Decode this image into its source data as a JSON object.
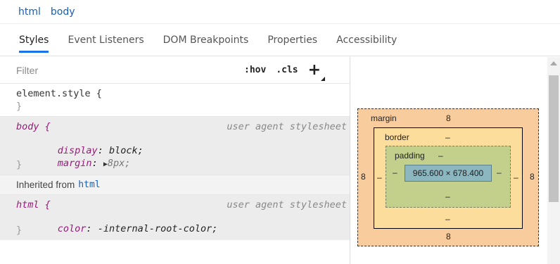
{
  "breadcrumb": [
    "html",
    "body"
  ],
  "tabs": [
    {
      "label": "Styles",
      "active": true
    },
    {
      "label": "Event Listeners",
      "active": false
    },
    {
      "label": "DOM Breakpoints",
      "active": false
    },
    {
      "label": "Properties",
      "active": false
    },
    {
      "label": "Accessibility",
      "active": false
    }
  ],
  "filter": {
    "placeholder": "Filter",
    "value": ""
  },
  "toolbar": {
    "hov": ":hov",
    "cls": ".cls",
    "add": "+"
  },
  "rules": {
    "element_style": {
      "selector": "element.style {",
      "close": "}"
    },
    "body": {
      "selector": "body {",
      "origin": "user agent stylesheet",
      "props": [
        {
          "name": "display",
          "value": "block;"
        },
        {
          "name": "margin",
          "value": "8px;"
        }
      ],
      "close": "}"
    },
    "inherited": {
      "text": "Inherited from",
      "from": "html"
    },
    "html": {
      "selector": "html {",
      "origin": "user agent stylesheet",
      "props": [
        {
          "name": "color",
          "value": "-internal-root-color;"
        }
      ],
      "close": "}"
    }
  },
  "box_model": {
    "margin": {
      "label": "margin",
      "top": "8",
      "right": "8",
      "bottom": "8",
      "left": "8"
    },
    "border": {
      "label": "border",
      "top": "–",
      "right": "–",
      "bottom": "–",
      "left": "–"
    },
    "padding": {
      "label": "padding",
      "top": "–",
      "right": "–",
      "bottom": "–",
      "left": "–"
    },
    "content": "965.600 × 678.400"
  },
  "colors": {
    "accent": "#1a73e8",
    "link": "#1a5fb4",
    "property": "#9a1a7a",
    "margin_bg": "#f9cc9d",
    "border_bg": "#fddd9b",
    "padding_bg": "#c3d08b",
    "content_bg": "#8cb6c0"
  }
}
